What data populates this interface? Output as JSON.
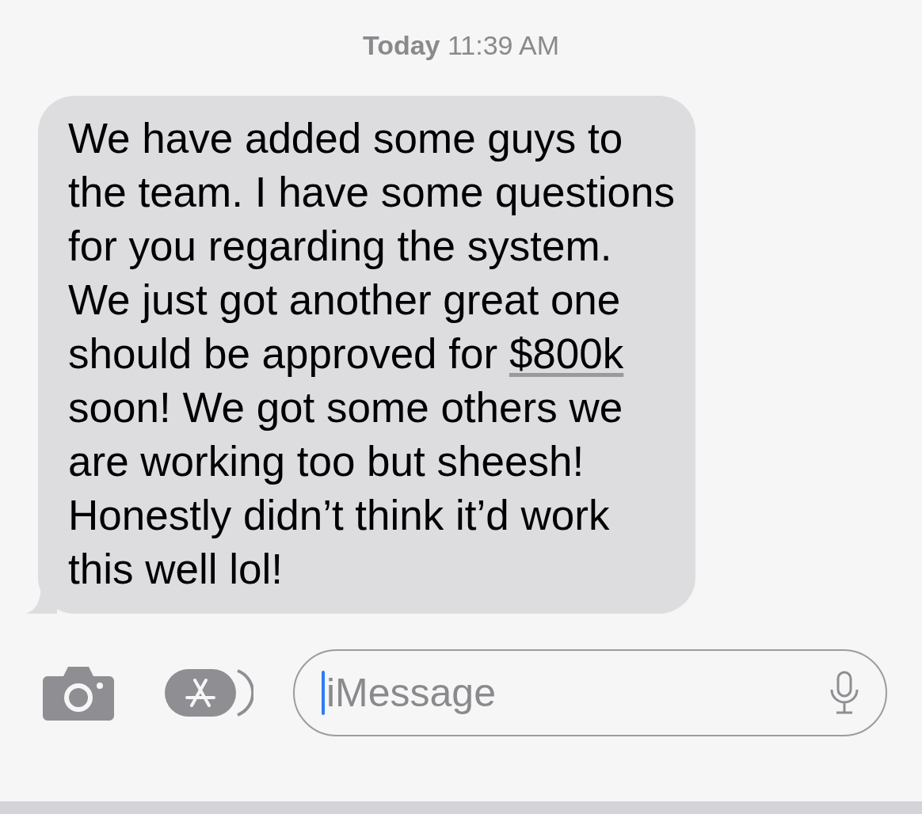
{
  "timestamp": "**Today** 11:39 AM",
  "message": {
    "text_before": "We have added some guys to the team. I have some questions for you regarding the system. We just got another great one should be approved for ",
    "link": "$800k",
    "text_after": " soon! We got some others we are working too but sheesh! Honestly didn’t think it’d work this well lol!"
  },
  "composer": {
    "placeholder": "iMessage"
  }
}
